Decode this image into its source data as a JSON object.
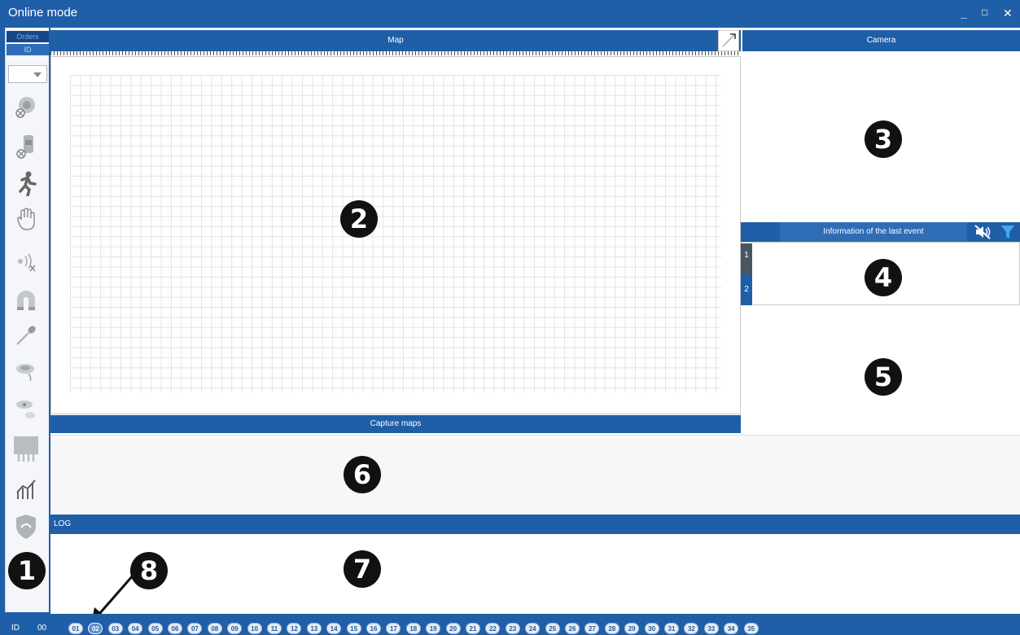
{
  "window": {
    "title": "Online mode",
    "min": "_",
    "max": "□",
    "close": "✕"
  },
  "sidebar": {
    "orders_label": "Orders",
    "id_label": "ID",
    "tools": [
      "detector-off-icon",
      "sensor-off-icon",
      "running-man-icon",
      "hand-icon",
      "sound-wave-icon",
      "magnet-icon",
      "probe-icon",
      "smoke-detector-icon",
      "smoke-detector-2-icon",
      "relay-module-icon",
      "chart-icon",
      "shield-icon"
    ]
  },
  "map": {
    "header": "Map"
  },
  "camera": {
    "header": "Camera"
  },
  "event": {
    "header": "Information of the last event",
    "tab1": "1",
    "tab2": "2"
  },
  "capture": {
    "header": "Capture maps"
  },
  "log": {
    "header": "LOG"
  },
  "callouts": {
    "c1": "1",
    "c2": "2",
    "c3": "3",
    "c4": "4",
    "c5": "5",
    "c6": "6",
    "c7": "7",
    "c8": "8"
  },
  "status": {
    "id_label": "ID",
    "id_value": "00",
    "chips": [
      "01",
      "02",
      "03",
      "04",
      "05",
      "06",
      "07",
      "08",
      "09",
      "10",
      "11",
      "12",
      "13",
      "14",
      "15",
      "16",
      "17",
      "18",
      "19",
      "20",
      "21",
      "22",
      "23",
      "24",
      "25",
      "26",
      "27",
      "28",
      "29",
      "30",
      "31",
      "32",
      "33",
      "34",
      "35"
    ],
    "active_chip": "02"
  },
  "colors": {
    "accent": "#1f5fa8",
    "dark": "#111111"
  }
}
